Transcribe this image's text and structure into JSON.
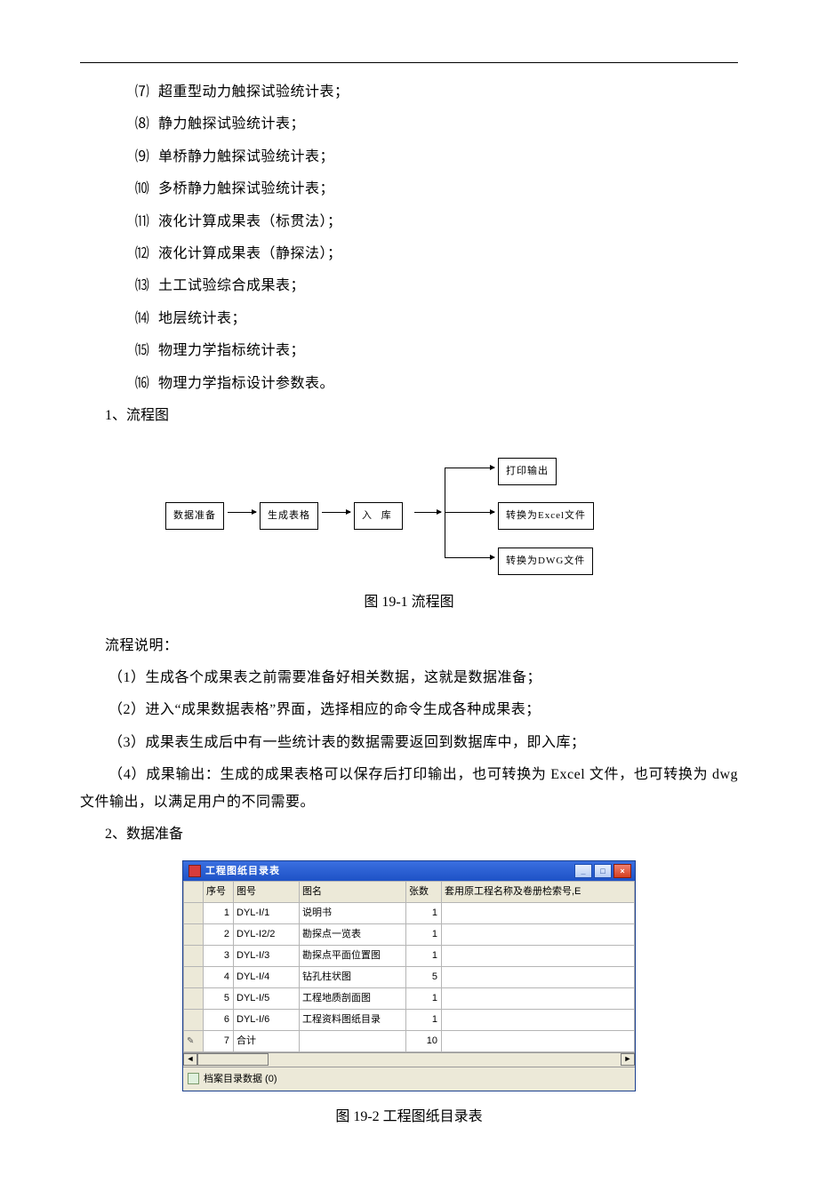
{
  "list": [
    {
      "n": "⑺",
      "text": "超重型动力触探试验统计表；"
    },
    {
      "n": "⑻",
      "text": "静力触探试验统计表；"
    },
    {
      "n": "⑼",
      "text": "单桥静力触探试验统计表；"
    },
    {
      "n": "⑽",
      "text": "多桥静力触探试验统计表；"
    },
    {
      "n": "⑾",
      "text": "液化计算成果表（标贯法）；"
    },
    {
      "n": "⑿",
      "text": "液化计算成果表（静探法）；"
    },
    {
      "n": "⒀",
      "text": "土工试验综合成果表；"
    },
    {
      "n": "⒁",
      "text": "地层统计表；"
    },
    {
      "n": "⒂",
      "text": "物理力学指标统计表；"
    },
    {
      "n": "⒃",
      "text": "物理力学指标设计参数表。"
    }
  ],
  "sec1": "1、流程图",
  "flow": {
    "n1": "数据准备",
    "n2": "生成表格",
    "n3": "入  库",
    "o1": "打印输出",
    "o2": "转换为Excel文件",
    "o3": "转换为DWG文件"
  },
  "fig1_caption": "图 19-1  流程图",
  "explain_head": "流程说明：",
  "explain": [
    "（1）生成各个成果表之前需要准备好相关数据，这就是数据准备；",
    "（2）进入“成果数据表格”界面，选择相应的命令生成各种成果表；",
    "（3）成果表生成后中有一些统计表的数据需要返回到数据库中，即入库；",
    "（4）成果输出：生成的成果表格可以保存后打印输出，也可转换为 Excel 文件，也可转换为 dwg 文件输出，以满足用户的不同需要。"
  ],
  "sec2": "2、数据准备",
  "win": {
    "title": "工程图纸目录表",
    "headers": [
      "",
      "序号",
      "图号",
      "图名",
      "张数",
      "套用原工程名称及卷册检索号,E"
    ],
    "rows": [
      [
        "",
        "1",
        "DYL-I/1",
        "说明书",
        "1",
        ""
      ],
      [
        "",
        "2",
        "DYL-I2/2",
        "勘探点一览表",
        "1",
        ""
      ],
      [
        "",
        "3",
        "DYL-I/3",
        "勘探点平面位置图",
        "1",
        ""
      ],
      [
        "",
        "4",
        "DYL-I/4",
        "钻孔柱状图",
        "5",
        ""
      ],
      [
        "",
        "5",
        "DYL-I/5",
        "工程地质剖面图",
        "1",
        ""
      ],
      [
        "",
        "6",
        "DYL-I/6",
        "工程资料图纸目录",
        "1",
        ""
      ],
      [
        "✎",
        "7",
        "合计",
        "",
        "10",
        ""
      ]
    ],
    "status": "档案目录数据 (0)"
  },
  "fig2_caption": "图 19-2  工程图纸目录表",
  "chart_data": {
    "type": "table",
    "title": "工程图纸目录表",
    "columns": [
      "序号",
      "图号",
      "图名",
      "张数",
      "套用原工程名称及卷册检索号"
    ],
    "rows": [
      [
        1,
        "DYL-I/1",
        "说明书",
        1,
        ""
      ],
      [
        2,
        "DYL-I2/2",
        "勘探点一览表",
        1,
        ""
      ],
      [
        3,
        "DYL-I/3",
        "勘探点平面位置图",
        1,
        ""
      ],
      [
        4,
        "DYL-I/4",
        "钻孔柱状图",
        5,
        ""
      ],
      [
        5,
        "DYL-I/5",
        "工程地质剖面图",
        1,
        ""
      ],
      [
        6,
        "DYL-I/6",
        "工程资料图纸目录",
        1,
        ""
      ],
      [
        7,
        "合计",
        "",
        10,
        ""
      ]
    ]
  }
}
